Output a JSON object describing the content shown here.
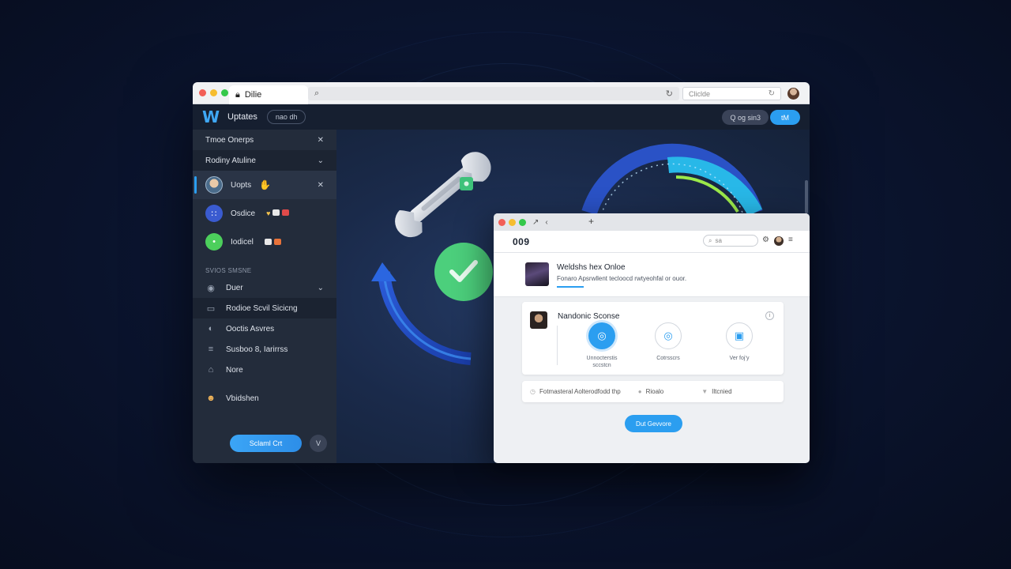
{
  "browser": {
    "tab_title": "Dilie",
    "search_placeholder": "Cliclde"
  },
  "header": {
    "app_title": "Uptates",
    "pill_label": "nao dh",
    "ghost_button": "Q og sin3",
    "primary_button": "tM"
  },
  "sidebar": {
    "row1_label": "Tmoe  Onerps",
    "row2_label": "Rodiny Atuline",
    "items": [
      {
        "label": "Uopts"
      },
      {
        "label": "Osdice"
      },
      {
        "label": "Iodicel"
      }
    ],
    "section_title": "SVIOS SMSNE",
    "nav": [
      {
        "label": "Duer"
      },
      {
        "label": "Rodioe Scvil Sicicng"
      },
      {
        "label": "Ooctis Asvres"
      },
      {
        "label": "Susboo 8, Iarirrss"
      },
      {
        "label": "Nore"
      },
      {
        "label": "Vbidshen"
      }
    ],
    "cta_label": "Sclaml Crt",
    "round_label": "V"
  },
  "popup": {
    "title": "009",
    "search_placeholder": "sa",
    "hero_title": "Weldshs hex Onloe",
    "hero_sub": "Fonaro Apsrwllent tecloocd rwtyeohfal or ouor.",
    "card_title": "Nandonic Sconse",
    "options": [
      {
        "label": "Unnocterstis\nsccstcn"
      },
      {
        "label": "Cotrsscrs"
      },
      {
        "label": "Ver foj’y"
      }
    ],
    "row_items": [
      {
        "label": "Fotmasteral Aolterodfodd thp"
      },
      {
        "label": "Rioalo"
      },
      {
        "label": "Iltcnied"
      }
    ],
    "cta_label": "Dut Gevvore"
  },
  "colors": {
    "accent": "#2b9ef0",
    "success": "#4ccf7c",
    "sidebar_bg": "#232c3b",
    "header_bg": "#161f30"
  }
}
